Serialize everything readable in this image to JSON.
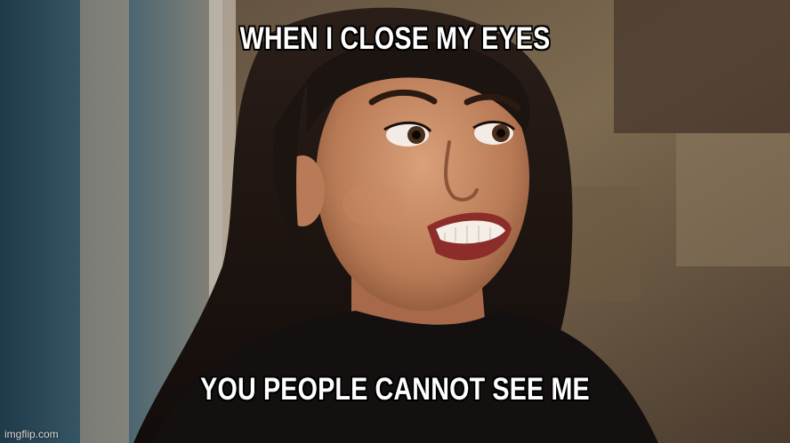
{
  "meme": {
    "top_text": "WHEN I CLOSE MY EYES",
    "bottom_text": "YOU PEOPLE CANNOT SEE ME",
    "watermark": "imgflip.com"
  },
  "colors": {
    "caption_fill": "#ffffff",
    "caption_outline": "#000000"
  }
}
